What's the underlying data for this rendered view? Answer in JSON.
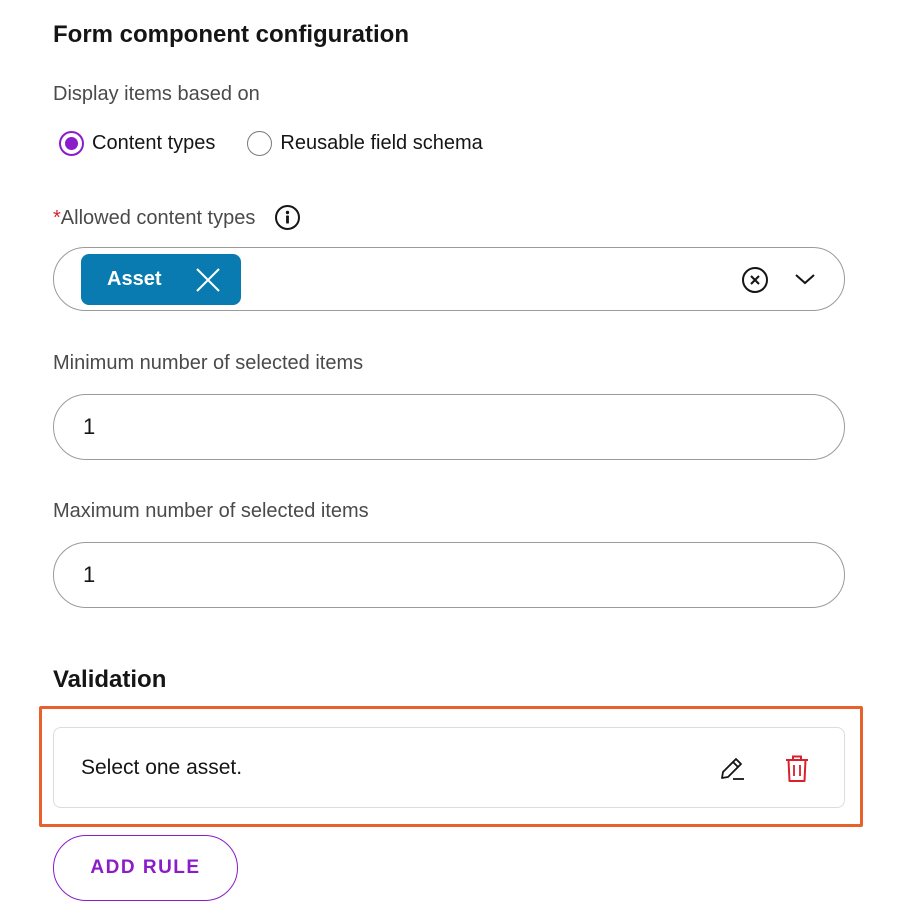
{
  "form_config": {
    "title": "Form component configuration",
    "display_items_label": "Display items based on",
    "display_options": [
      {
        "label": "Content types",
        "selected": true
      },
      {
        "label": "Reusable field schema",
        "selected": false
      }
    ],
    "allowed_types": {
      "required_marker": "*",
      "label": "Allowed content types",
      "info_icon": "info-icon",
      "tags": [
        {
          "label": "Asset"
        }
      ]
    },
    "min_items": {
      "label": "Minimum number of selected items",
      "value": "1"
    },
    "max_items": {
      "label": "Maximum number of selected items",
      "value": "1"
    }
  },
  "validation": {
    "title": "Validation",
    "rules": [
      {
        "text": "Select one asset."
      }
    ],
    "add_rule_label": "ADD RULE"
  },
  "colors": {
    "accent": "#8a1cc9",
    "tag_bg": "#0a7bb0",
    "required": "#d9202c",
    "delete": "#d9202c",
    "highlight": "#e8602c"
  }
}
